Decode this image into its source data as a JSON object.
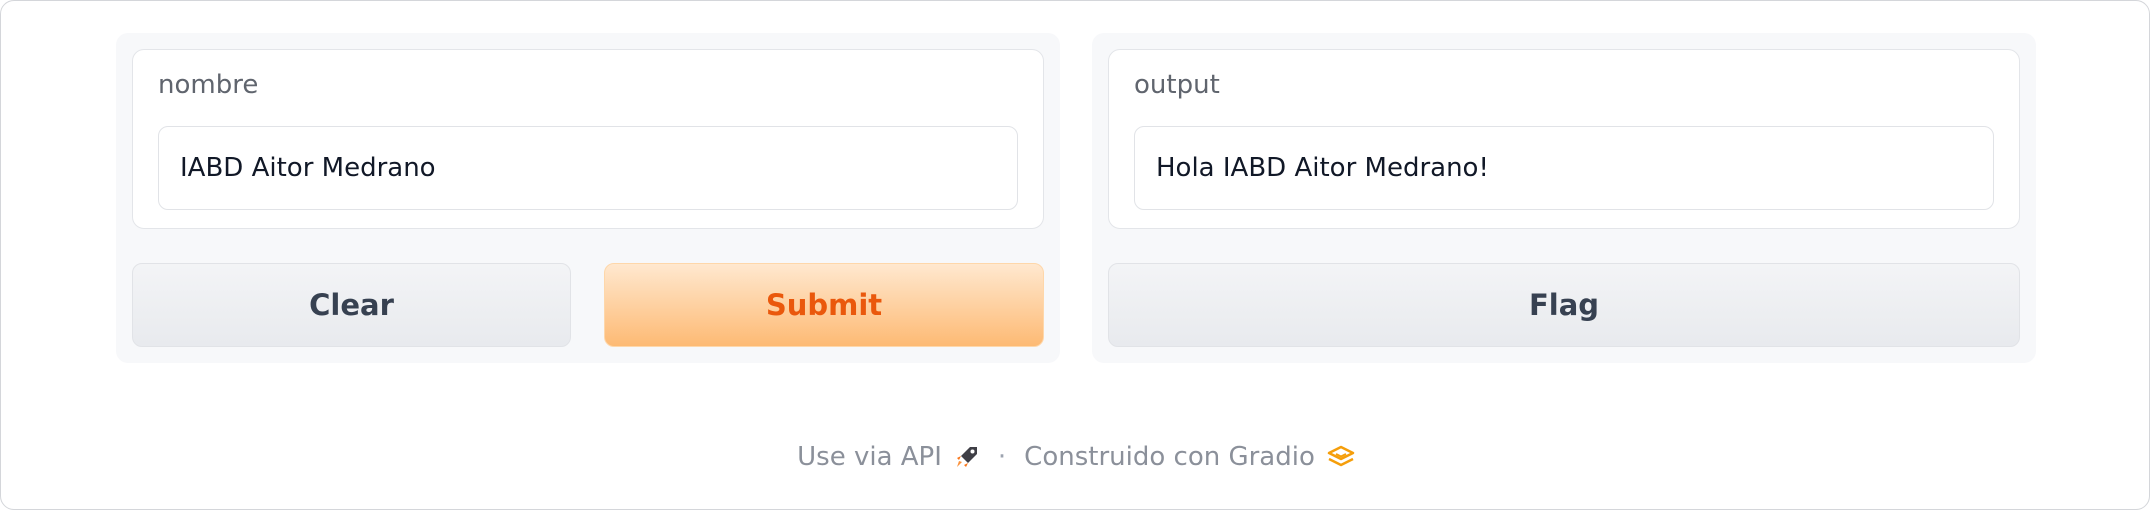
{
  "inputs": {
    "nombre": {
      "label": "nombre",
      "value": "IABD Aitor Medrano"
    }
  },
  "outputs": {
    "output": {
      "label": "output",
      "value": "Hola IABD Aitor Medrano!"
    }
  },
  "buttons": {
    "clear": "Clear",
    "submit": "Submit",
    "flag": "Flag"
  },
  "footer": {
    "api_link": "Use via API",
    "api_icon": "rocket-icon",
    "separator": "·",
    "built_with": "Construido con Gradio",
    "gradio_icon": "gradio-logo-icon"
  },
  "colors": {
    "primary_text": "#ea580c",
    "primary_bg_start": "#ffe8cf",
    "primary_bg_end": "#fdba74",
    "accent": "#f59e0b"
  }
}
